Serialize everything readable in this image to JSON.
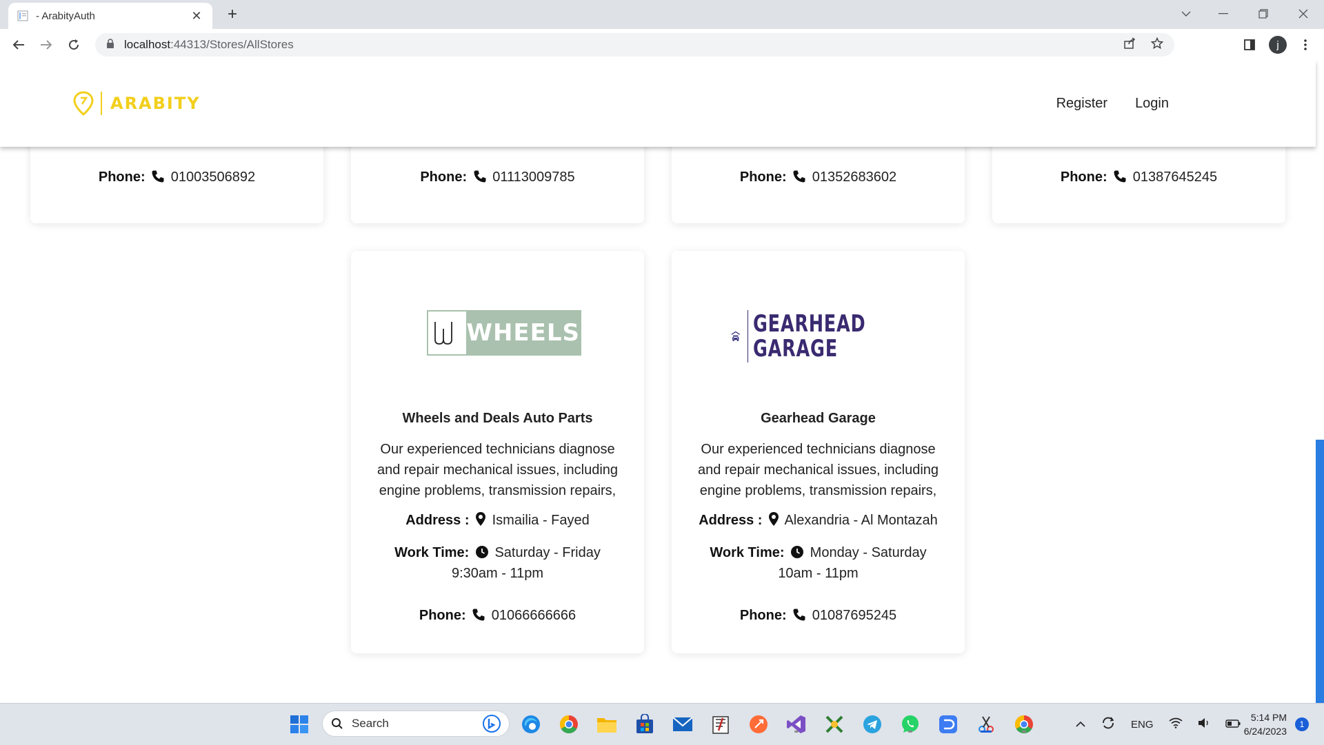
{
  "browser": {
    "tab_title": "- ArabityAuth",
    "url_host": "localhost",
    "url_rest": ":44313/Stores/AllStores"
  },
  "site": {
    "brand": "ARABITY",
    "brand_color": "#f2cf1c",
    "nav": {
      "register": "Register",
      "login": "Login"
    }
  },
  "labels": {
    "address": "Address :",
    "work_time": "Work Time:",
    "phone": "Phone:"
  },
  "top_row_phones": [
    "01003506892",
    "01113009785",
    "01352683602",
    "01387645245"
  ],
  "stores": [
    {
      "logo_text": "WHEELS",
      "logo_mark": "W",
      "name": "Wheels and Deals Auto Parts",
      "description": "Our experienced technicians diagnose and repair mechanical issues, including engine problems, transmission repairs,",
      "address": "Ismailia - Fayed",
      "work_time": "Saturday - Friday 9:30am - 11pm",
      "phone": "01066666666"
    },
    {
      "logo_line1": "GEARHEAD",
      "logo_line2": "GARAGE",
      "name": "Gearhead Garage",
      "description": "Our experienced technicians diagnose and repair mechanical issues, including engine problems, transmission repairs,",
      "address": "Alexandria - Al Montazah",
      "work_time": "Monday - Saturday 10am - 11pm",
      "phone": "01087695245"
    }
  ],
  "taskbar": {
    "search_placeholder": "Search",
    "language": "ENG",
    "time": "5:14 PM",
    "date": "6/24/2023",
    "notification_count": "1"
  }
}
